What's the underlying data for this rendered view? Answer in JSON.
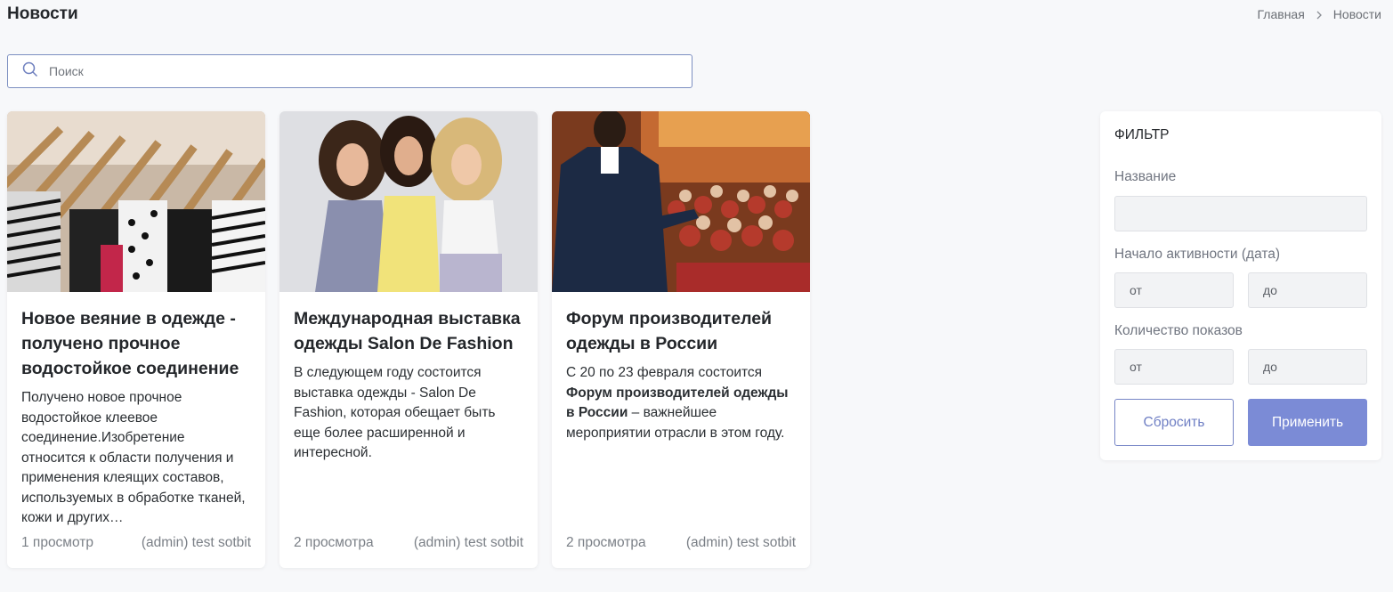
{
  "header": {
    "title": "Новости"
  },
  "breadcrumb": {
    "home": "Главная",
    "current": "Новости"
  },
  "search": {
    "placeholder": "Поиск"
  },
  "cards": [
    {
      "image": "clothes-on-hangers-photo",
      "title": "Новое веяние в одежде - получено прочное водостойкое соединение",
      "text": "Получено новое прочное водостойкое клеевое соединение.Изобретение относится к области получения и применения клеящих составов, используемых в обработке тканей, кожи и других…",
      "views": "1 просмотр",
      "author": "(admin) test sotbit"
    },
    {
      "image": "three-models-photo",
      "title": "Международная выставка одежды Salon De Fashion",
      "text": "В следующем году состоится выставка одежды - Salon De Fashion, которая обещает быть еще более расширенной и интересной.",
      "views": "2 просмотра",
      "author": "(admin) test sotbit"
    },
    {
      "image": "conference-speaker-photo",
      "title": "Форум производителей одежды в России",
      "text_before": "С 20 по 23 февраля состоится ",
      "text_bold": "Форум производителей одежды в России",
      "text_after": " – важнейшее мероприятии отрасли в этом году.",
      "views": "2 просмотра",
      "author": "(admin) test sotbit"
    }
  ],
  "filter": {
    "title": "ФИЛЬТР",
    "name_label": "Название",
    "name_value": "",
    "date_label": "Начало активности (дата)",
    "date_from": "от",
    "date_to": "до",
    "views_label": "Количество показов",
    "views_from": "от",
    "views_to": "до",
    "reset_label": "Сбросить",
    "apply_label": "Применить"
  },
  "colors": {
    "accent": "#7b8bd6",
    "accent_border": "#7685c6",
    "search_border": "#7c8fc1",
    "background": "#f7f8fa"
  }
}
